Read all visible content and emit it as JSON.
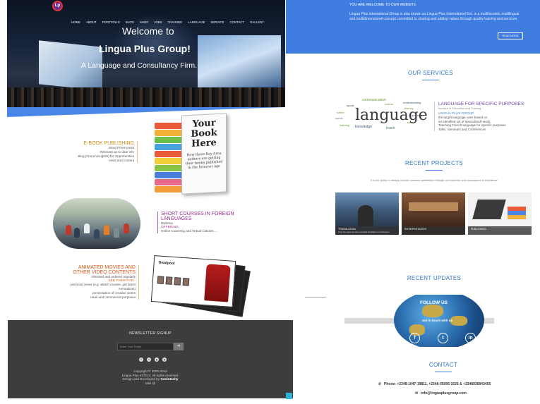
{
  "colors": {
    "accent": "#3f7ee0",
    "gold": "#c98a18",
    "purple": "#9b2c8f",
    "orange": "#d35a1a",
    "footer": "#3d3d3d"
  },
  "hero": {
    "logo_text": "Lp",
    "nav": [
      "HOME",
      "ABOUT",
      "PORTFOLIO",
      "BLOG",
      "SHOP",
      "JOBS",
      "TRAINING",
      "LANGUAGE",
      "SERVICE",
      "CONTACT",
      "GALLERY"
    ],
    "welcome": "Welcome to",
    "brand": "Lingua Plus Group!",
    "tagline": "A Language and Consultancy Firm."
  },
  "ebook": {
    "title": "E-BOOK PUBLISHING",
    "sub": "Word Press posts",
    "lines": [
      "Relevant up to date info",
      "Blog (French-English) for Opportunities",
      "news and content"
    ],
    "book": {
      "title": "Your Book Here",
      "blurb": "How three Bay Area authors are getting their books published in the Internet age"
    }
  },
  "short_courses": {
    "title": "SHORT COURSES IN FOREIGN LANGUAGES",
    "sub": "Diploma",
    "offering_label": "OFFERING",
    "offering": "Online Coaching and Virtual Classes ..."
  },
  "animated": {
    "title": "ANIMATED MOVIES AND OTHER VIDEO CONTENTS",
    "sub": "released and ordered regularly",
    "see_label": "SEE THEM FOR :",
    "lines": [
      "personal views (e.g. Watch movies, get latest",
      "Animations)",
      "presentation of creative works",
      "retail and commercial purposes"
    ],
    "poster_title": "Deadpool"
  },
  "newsletter": {
    "heading": "NEWSLETTER SIGNUP",
    "placeholder": "Enter Your Email",
    "social_icons": [
      "facebook-icon",
      "twitter-icon",
      "google-plus-icon",
      "pinterest-icon"
    ],
    "copyright": "Copyright © 2006-2018",
    "rights": "Lingua Plus Int'l Ent. All rights reserved.",
    "designed_by": "Design and Developed by",
    "developer": "Genintechy",
    "mail": "Mail @"
  },
  "welcome_box": {
    "title": "YOU ARE WELCOME TO OUR WEBSITE.",
    "desc": "Lingua Plus International Group is also known as Lingua Plus International Ent. is a multifaceted, multilingual and multidimensional concept committed to sharing and adding values through quality training and services.",
    "button": "READ MORE"
  },
  "services": {
    "heading": "OUR SERVICES",
    "lsp_title": "LANGUAGE FOR SPECIFIC PURPOSES",
    "lsp_sub": "focused in Education and Training",
    "group_label": "LINGUA PLUS GROUP",
    "lines": [
      "the target language uses based on",
      "an identified set of specialized needs",
      "Teaching French language for specific purposes",
      "Talks, Seminars and Conferences"
    ],
    "cloud_word": "language"
  },
  "projects": {
    "heading": "RECENT PROJECTS",
    "intro": "It is our policy to always provide customer satisfaction through our expertise and commitment to excellence",
    "items": [
      {
        "label": "TRANSLATION",
        "caption": "Over the years we have provided translation to businesses"
      },
      {
        "label": "INTERPRETATION",
        "caption": ""
      },
      {
        "label": "PUBLISHING",
        "caption": ""
      }
    ]
  },
  "updates": {
    "heading": "RECENT UPDATES",
    "follow": "FOLLOW US",
    "contact_text": "Get in touch with us"
  },
  "contact": {
    "heading": "CONTACT",
    "phone": "Phone: +2348-1047-19811, +2348-05095-1626 & +2348036843455",
    "email": "info@linguaplusgroup.com"
  }
}
